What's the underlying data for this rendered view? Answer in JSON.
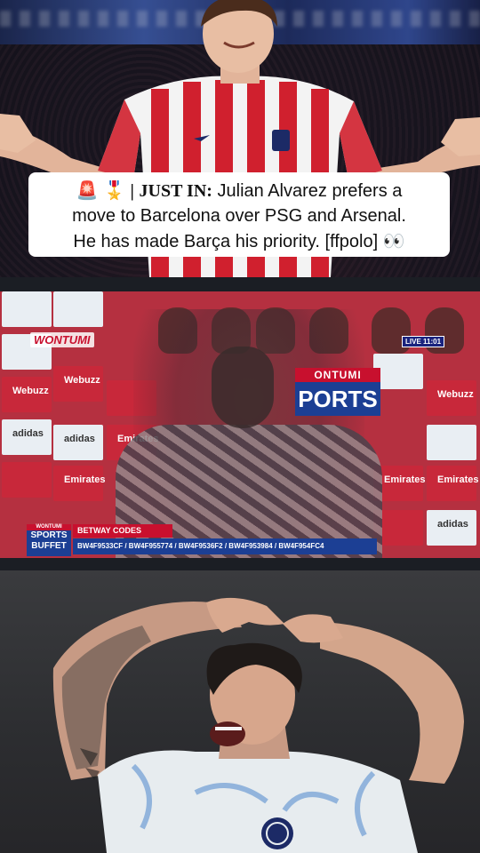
{
  "caption": {
    "icons": [
      "🚨",
      "🎖️"
    ],
    "separator": "|",
    "just_in": "JUST IN:",
    "line1_rest": "Julian Alvarez prefers a",
    "line2": "move to Barcelona over PSG and Arsenal.",
    "line3": "He has made Barça his priority. [ffpolo]",
    "trail_icon": "👀"
  },
  "tv_broadcast": {
    "channel_logo": "WONTUMI",
    "live_label": "LIVE",
    "live_time": "11:01",
    "backdrop_sign_top": "ONTUMI",
    "backdrop_sign_bottom": "PORTS",
    "sponsor_marks": [
      "adidas",
      "Emirates",
      "Webuzz"
    ],
    "show_logo": {
      "line1": "WONTUMI",
      "line2": "SPORTS",
      "line3": "BUFFET"
    },
    "ticker_title": "BETWAY CODES",
    "ticker_codes": "BW4F9533CF / BW4F955774 / BW4F9536F2 / BW4F953984 / BW4F954FC4"
  },
  "colors": {
    "caption_bg": "#ffffff",
    "broadcast_red": "#c8102e",
    "broadcast_blue": "#1c3f94",
    "atletico_red": "#d0202e",
    "inter_kit_white": "#e7ecef"
  }
}
